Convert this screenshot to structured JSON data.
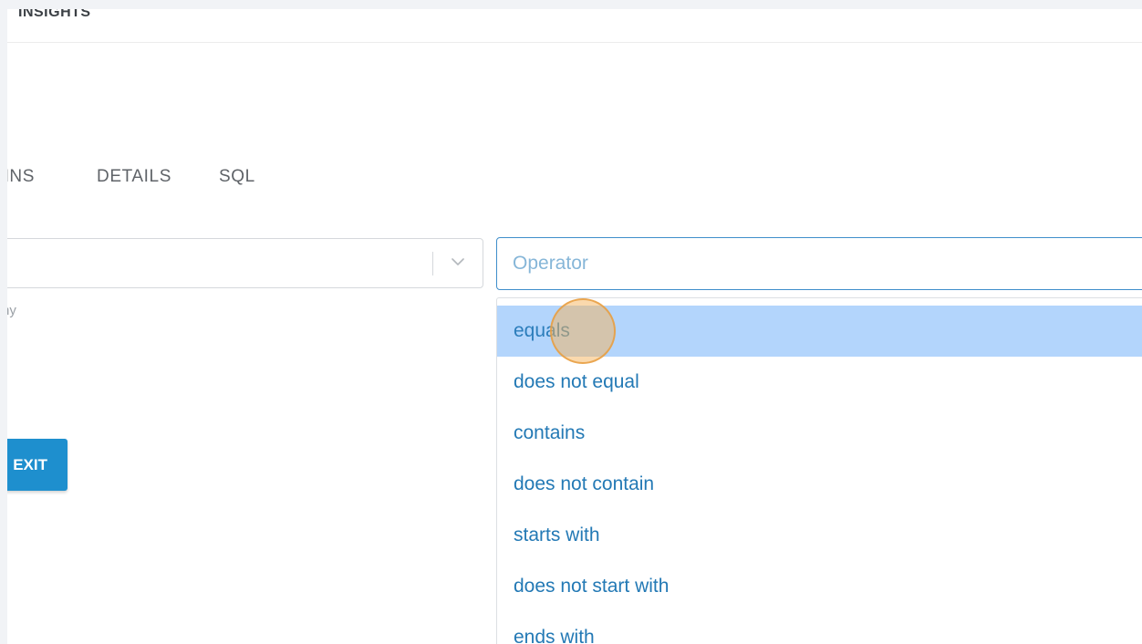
{
  "header": {
    "title": "INSIGHTS"
  },
  "tabs": [
    {
      "label": "MNS"
    },
    {
      "label": "DETAILS"
    },
    {
      "label": "SQL"
    }
  ],
  "field_select": {
    "value": "",
    "helper_text": "ny",
    "chevron_icon": "chevron-down-icon"
  },
  "exit_button": {
    "label": "EXIT"
  },
  "operator": {
    "placeholder": "Operator",
    "options": [
      {
        "label": "equals",
        "highlighted": true
      },
      {
        "label": "does not equal"
      },
      {
        "label": "contains"
      },
      {
        "label": "does not contain"
      },
      {
        "label": "starts with"
      },
      {
        "label": "does not start with"
      },
      {
        "label": "ends with"
      }
    ]
  },
  "colors": {
    "accent": "#1e8fce",
    "option_text": "#2379b5",
    "option_highlight": "#b3d5fc",
    "input_border_focus": "#3f8ecb",
    "click_indicator": "#f6b35c"
  }
}
